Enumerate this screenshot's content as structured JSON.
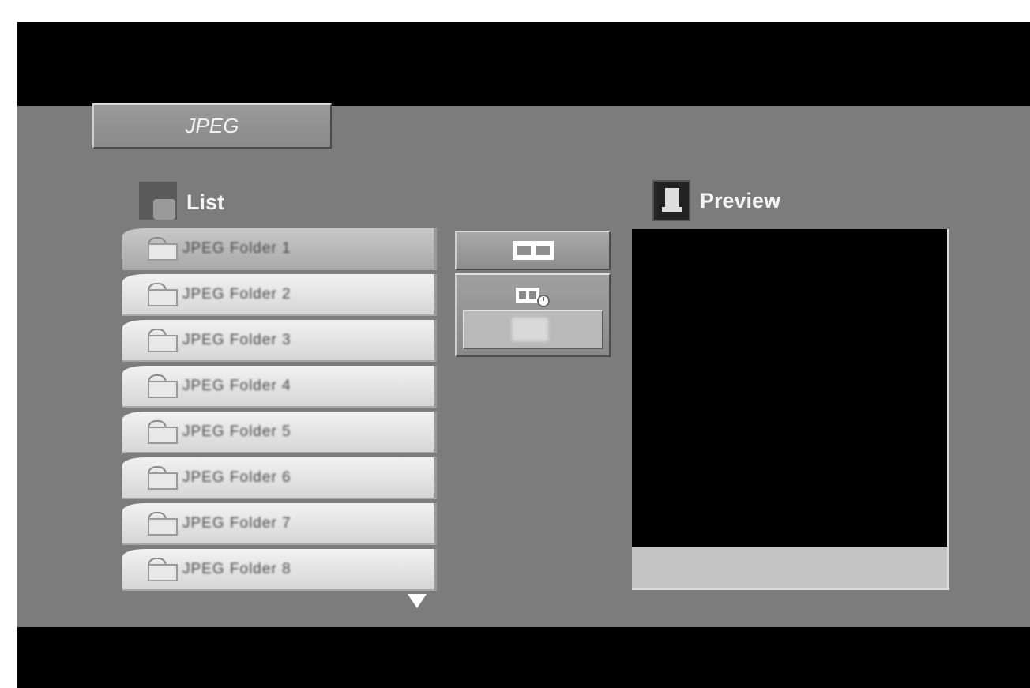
{
  "menu": {
    "tab_label": "JPEG",
    "list_label": "List",
    "preview_label": "Preview"
  },
  "list": {
    "items": [
      {
        "label": "JPEG Folder 1",
        "selected": true
      },
      {
        "label": "JPEG Folder 2",
        "selected": false
      },
      {
        "label": "JPEG Folder 3",
        "selected": false
      },
      {
        "label": "JPEG Folder 4",
        "selected": false
      },
      {
        "label": "JPEG Folder 5",
        "selected": false
      },
      {
        "label": "JPEG Folder 6",
        "selected": false
      },
      {
        "label": "JPEG Folder 7",
        "selected": false
      },
      {
        "label": "JPEG Folder 8",
        "selected": false
      }
    ]
  },
  "icons": {
    "list": "folder-stack-icon",
    "preview": "picture-icon",
    "slideshow": "filmstrip-icon",
    "slideshow_speed": "filmstrip-timer-icon",
    "scroll": "scroll-down-icon"
  }
}
